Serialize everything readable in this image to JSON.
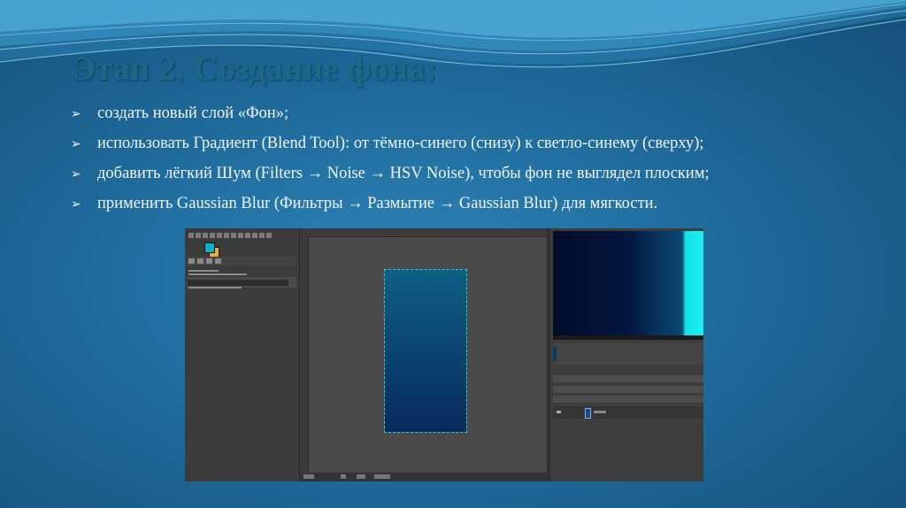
{
  "slide": {
    "title": "Этап 2. Создание фона:",
    "bullet_marker": "➢",
    "bullets": [
      "создать новый слой «Фон»;",
      "использовать Градиент (Blend Tool): от тёмно-синего (снизу) к светло-синему (сверху);",
      "добавить лёгкий Шум (Filters → Noise → HSV Noise), чтобы фон не выглядел плоским;",
      "применить Gaussian Blur (Фильтры → Размытие → Gaussian Blur) для мягкости."
    ]
  },
  "gimp": {
    "foreground_color": "#0fb3c9",
    "background_color": "#e8b030",
    "canvas_gradient": [
      "#0f5f86",
      "#072a5c"
    ]
  }
}
